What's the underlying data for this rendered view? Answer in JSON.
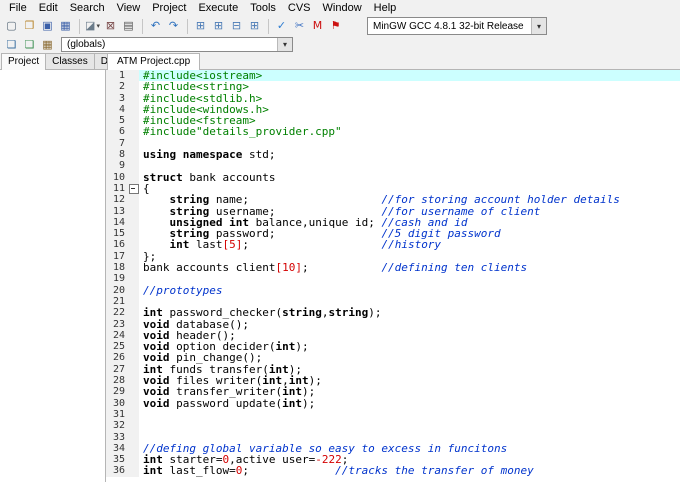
{
  "glyphs": {
    "chevron_down": "▾"
  },
  "menu": {
    "items": [
      "File",
      "Edit",
      "Search",
      "View",
      "Project",
      "Execute",
      "Tools",
      "CVS",
      "Window",
      "Help"
    ]
  },
  "toolbar_main": {
    "icons": [
      {
        "name": "new-file-icon",
        "glyph": "▢",
        "color": "#5a6b7a"
      },
      {
        "name": "open-file-icon",
        "glyph": "❐",
        "color": "#b9872f"
      },
      {
        "name": "save-icon",
        "glyph": "▣",
        "color": "#3a5fa8"
      },
      {
        "name": "save-all-icon",
        "glyph": "▦",
        "color": "#3a5fa8"
      },
      {
        "sep": true
      },
      {
        "name": "new-project-icon",
        "glyph": "◪",
        "color": "#6a7b8a",
        "arrow": true
      },
      {
        "name": "close-file-icon",
        "glyph": "⊠",
        "color": "#7a4a4a"
      },
      {
        "name": "print-icon",
        "glyph": "▤",
        "color": "#555555"
      },
      {
        "sep": true
      },
      {
        "name": "undo-icon",
        "glyph": "↶",
        "color": "#2a6fbd"
      },
      {
        "name": "redo-icon",
        "glyph": "↷",
        "color": "#2a6fbd"
      },
      {
        "sep": true
      },
      {
        "name": "compile-icon",
        "glyph": "⊞",
        "color": "#4a7ab5"
      },
      {
        "name": "run-icon",
        "glyph": "⊞",
        "color": "#4a7ab5"
      },
      {
        "name": "compile-run-icon",
        "glyph": "⊟",
        "color": "#4a7ab5"
      },
      {
        "name": "rebuild-icon",
        "glyph": "⊞",
        "color": "#4a7ab5"
      },
      {
        "sep": true
      },
      {
        "name": "syntax-check-icon",
        "glyph": "✓",
        "color": "#2e7dd1"
      },
      {
        "name": "abort-compile-icon",
        "glyph": "✂",
        "color": "#3a6fc1"
      },
      {
        "name": "profile-icon",
        "glyph": "M",
        "color": "#cc1111"
      },
      {
        "name": "profiling-analysis-icon",
        "glyph": "⚑",
        "color": "#cc1111"
      }
    ],
    "compiler_select": {
      "value": "MinGW GCC 4.8.1 32-bit Release"
    }
  },
  "toolbar_class": {
    "icons": [
      {
        "name": "goto-declaration-icon",
        "glyph": "❏",
        "color": "#3a6fa0"
      },
      {
        "name": "goto-definition-icon",
        "glyph": "❏",
        "color": "#3a8f50"
      },
      {
        "name": "class-browser-icon",
        "glyph": "▦",
        "color": "#8a6a30"
      }
    ],
    "globals_select": {
      "value": "(globals)"
    }
  },
  "left_panel": {
    "tabs": [
      {
        "label": "Project",
        "active": true
      },
      {
        "label": "Classes",
        "active": false
      },
      {
        "label": "Debug",
        "active": false
      }
    ]
  },
  "editor": {
    "tabs": [
      {
        "label": "ATM Project.cpp",
        "active": true
      }
    ]
  },
  "code": {
    "current_line": 1,
    "fold_lines": [
      11
    ],
    "lines": [
      {
        "n": 1,
        "t": [
          [
            "pp",
            "#include<iostream>"
          ]
        ]
      },
      {
        "n": 2,
        "t": [
          [
            "pp",
            "#include<string>"
          ]
        ]
      },
      {
        "n": 3,
        "t": [
          [
            "pp",
            "#include<stdlib.h>"
          ]
        ]
      },
      {
        "n": 4,
        "t": [
          [
            "pp",
            "#include<windows.h>"
          ]
        ]
      },
      {
        "n": 5,
        "t": [
          [
            "pp",
            "#include<fstream>"
          ]
        ]
      },
      {
        "n": 6,
        "t": [
          [
            "pp",
            "#include\"details_provider.cpp\""
          ]
        ]
      },
      {
        "n": 7,
        "t": []
      },
      {
        "n": 8,
        "t": [
          [
            "kw",
            "using"
          ],
          [
            "pl",
            " "
          ],
          [
            "kw",
            "namespace"
          ],
          [
            "pl",
            " std;"
          ]
        ]
      },
      {
        "n": 9,
        "t": []
      },
      {
        "n": 10,
        "t": [
          [
            "kw",
            "struct"
          ],
          [
            "pl",
            " bank_accounts"
          ]
        ]
      },
      {
        "n": 11,
        "t": [
          [
            "pl",
            "{"
          ]
        ]
      },
      {
        "n": 12,
        "t": [
          [
            "pl",
            "    "
          ],
          [
            "kw",
            "string"
          ],
          [
            "pl",
            " name;                    "
          ],
          [
            "com",
            "//for storing account holder details"
          ]
        ]
      },
      {
        "n": 13,
        "t": [
          [
            "pl",
            "    "
          ],
          [
            "kw",
            "string"
          ],
          [
            "pl",
            " username;                "
          ],
          [
            "com",
            "//for username of client"
          ]
        ]
      },
      {
        "n": 14,
        "t": [
          [
            "pl",
            "    "
          ],
          [
            "kw",
            "unsigned"
          ],
          [
            "pl",
            " "
          ],
          [
            "kw",
            "int"
          ],
          [
            "pl",
            " balance,unique_id; "
          ],
          [
            "com",
            "//cash and id"
          ]
        ]
      },
      {
        "n": 15,
        "t": [
          [
            "pl",
            "    "
          ],
          [
            "kw",
            "string"
          ],
          [
            "pl",
            " password;                "
          ],
          [
            "com",
            "//5 digit password"
          ]
        ]
      },
      {
        "n": 16,
        "t": [
          [
            "pl",
            "    "
          ],
          [
            "kw",
            "int"
          ],
          [
            "pl",
            " last"
          ],
          [
            "num",
            "[5]"
          ],
          [
            "pl",
            ";                    "
          ],
          [
            "com",
            "//history"
          ]
        ]
      },
      {
        "n": 17,
        "t": [
          [
            "pl",
            "};"
          ]
        ]
      },
      {
        "n": 18,
        "t": [
          [
            "pl",
            "bank_accounts client"
          ],
          [
            "num",
            "[10]"
          ],
          [
            "pl",
            ";           "
          ],
          [
            "com",
            "//defining ten clients"
          ]
        ]
      },
      {
        "n": 19,
        "t": []
      },
      {
        "n": 20,
        "t": [
          [
            "com",
            "//prototypes"
          ]
        ]
      },
      {
        "n": 21,
        "t": []
      },
      {
        "n": 22,
        "t": [
          [
            "kw",
            "int"
          ],
          [
            "pl",
            " password_checker("
          ],
          [
            "kw",
            "string"
          ],
          [
            "pl",
            ","
          ],
          [
            "kw",
            "string"
          ],
          [
            "pl",
            ");"
          ]
        ]
      },
      {
        "n": 23,
        "t": [
          [
            "kw",
            "void"
          ],
          [
            "pl",
            " database();"
          ]
        ]
      },
      {
        "n": 24,
        "t": [
          [
            "kw",
            "void"
          ],
          [
            "pl",
            " header();"
          ]
        ]
      },
      {
        "n": 25,
        "t": [
          [
            "kw",
            "void"
          ],
          [
            "pl",
            " option_decider("
          ],
          [
            "kw",
            "int"
          ],
          [
            "pl",
            ");"
          ]
        ]
      },
      {
        "n": 26,
        "t": [
          [
            "kw",
            "void"
          ],
          [
            "pl",
            " pin_change();"
          ]
        ]
      },
      {
        "n": 27,
        "t": [
          [
            "kw",
            "int"
          ],
          [
            "pl",
            " funds_transfer("
          ],
          [
            "kw",
            "int"
          ],
          [
            "pl",
            ");"
          ]
        ]
      },
      {
        "n": 28,
        "t": [
          [
            "kw",
            "void"
          ],
          [
            "pl",
            " files_writer("
          ],
          [
            "kw",
            "int"
          ],
          [
            "pl",
            ","
          ],
          [
            "kw",
            "int"
          ],
          [
            "pl",
            ");"
          ]
        ]
      },
      {
        "n": 29,
        "t": [
          [
            "kw",
            "void"
          ],
          [
            "pl",
            " transfer_writer("
          ],
          [
            "kw",
            "int"
          ],
          [
            "pl",
            ");"
          ]
        ]
      },
      {
        "n": 30,
        "t": [
          [
            "kw",
            "void"
          ],
          [
            "pl",
            " password_update("
          ],
          [
            "kw",
            "int"
          ],
          [
            "pl",
            ");"
          ]
        ]
      },
      {
        "n": 31,
        "t": []
      },
      {
        "n": 32,
        "t": []
      },
      {
        "n": 33,
        "t": []
      },
      {
        "n": 34,
        "t": [
          [
            "com",
            "//defing global variable so easy to excess in funcitons"
          ]
        ]
      },
      {
        "n": 35,
        "t": [
          [
            "kw",
            "int"
          ],
          [
            "pl",
            " starter="
          ],
          [
            "num",
            "0"
          ],
          [
            "pl",
            ",active_user="
          ],
          [
            "num",
            "-222"
          ],
          [
            "pl",
            ";"
          ]
        ]
      },
      {
        "n": 36,
        "t": [
          [
            "kw",
            "int"
          ],
          [
            "pl",
            " last_flow="
          ],
          [
            "num",
            "0"
          ],
          [
            "pl",
            ";             "
          ],
          [
            "com",
            "//tracks the transfer of money"
          ]
        ]
      }
    ]
  }
}
